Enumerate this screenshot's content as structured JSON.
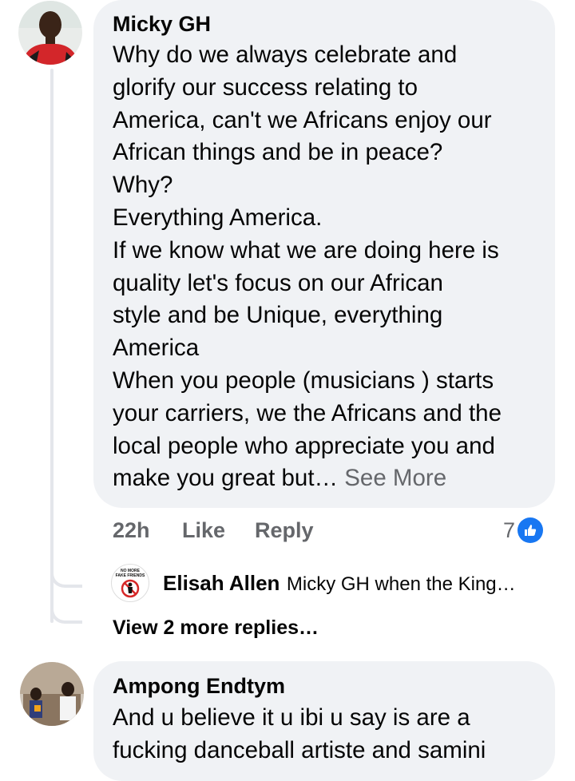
{
  "comments": [
    {
      "author": "Micky GH",
      "text_lines": [
        "Why do we always celebrate and",
        "glorify our success relating to",
        "America, can't we Africans enjoy our",
        "African things and be in peace?",
        "Why?",
        "Everything America.",
        "If we know what we are doing here is",
        "quality let's focus on our African",
        "style and be Unique, everything",
        "America",
        "When you people  (musicians ) starts",
        "your carriers, we the Africans and the",
        "local people who appreciate you and",
        "make you great but…"
      ],
      "see_more": "See More",
      "time": "22h",
      "like_label": "Like",
      "reply_label": "Reply",
      "reaction_count": "7",
      "reply_preview": {
        "author": "Elisah Allen",
        "text": "Micky GH when the King…",
        "avatar_caption": "NO MORE FAKE FRIENDS"
      },
      "view_more_replies": "View 2 more replies…"
    },
    {
      "author": "Ampong Endtym",
      "text_lines": [
        "And u believe it u ibi u say is are a",
        "fucking danceball artiste and samini"
      ]
    }
  ],
  "colors": {
    "bubble": "#f0f2f5",
    "meta": "#65676b",
    "like_blue": "#1877f2",
    "thread_line": "#e4e6eb"
  },
  "icons": {
    "reaction": "like-thumb-icon"
  }
}
